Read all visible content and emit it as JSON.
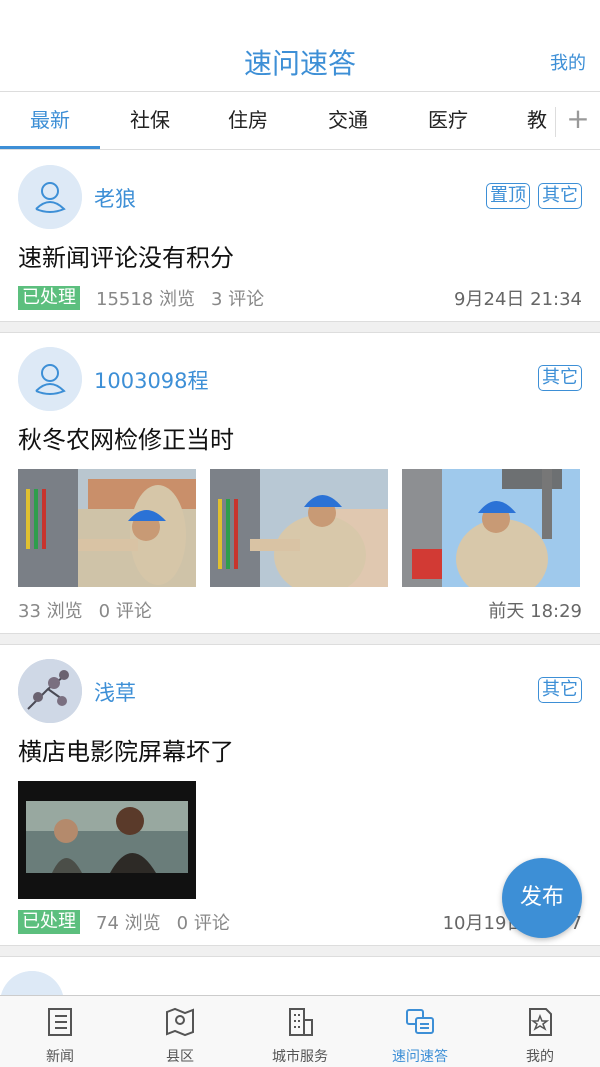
{
  "header": {
    "title": "速问速答",
    "mine_label": "我的"
  },
  "tabs": [
    {
      "label": "最新",
      "active": true
    },
    {
      "label": "社保",
      "active": false
    },
    {
      "label": "住房",
      "active": false
    },
    {
      "label": "交通",
      "active": false
    },
    {
      "label": "医疗",
      "active": false
    },
    {
      "label": "教",
      "active": false
    }
  ],
  "posts": [
    {
      "author": "老狼",
      "tags": [
        "置顶",
        "其它"
      ],
      "title": "速新闻评论没有积分",
      "status": "已处理",
      "views": "15518 浏览",
      "comments": "3 评论",
      "time": "9月24日 21:34"
    },
    {
      "author": "1003098程",
      "tags": [
        "其它"
      ],
      "title": "秋冬农网检修正当时",
      "status": "",
      "views": "33 浏览",
      "comments": "0 评论",
      "time": "前天 18:29"
    },
    {
      "author": "浅草",
      "tags": [
        "其它"
      ],
      "title": "横店电影院屏幕坏了",
      "status": "已处理",
      "views": "74 浏览",
      "comments": "0 评论",
      "time": "10月19日 19:57"
    }
  ],
  "fab_label": "发布",
  "bottom_nav": [
    {
      "label": "新闻",
      "icon": "news-icon",
      "active": false
    },
    {
      "label": "县区",
      "icon": "map-icon",
      "active": false
    },
    {
      "label": "城市服务",
      "icon": "building-icon",
      "active": false
    },
    {
      "label": "速问速答",
      "icon": "qa-icon",
      "active": true
    },
    {
      "label": "我的",
      "icon": "profile-star-icon",
      "active": false
    }
  ],
  "colors": {
    "accent": "#3d8fd6",
    "done_badge": "#5cbf7e"
  }
}
